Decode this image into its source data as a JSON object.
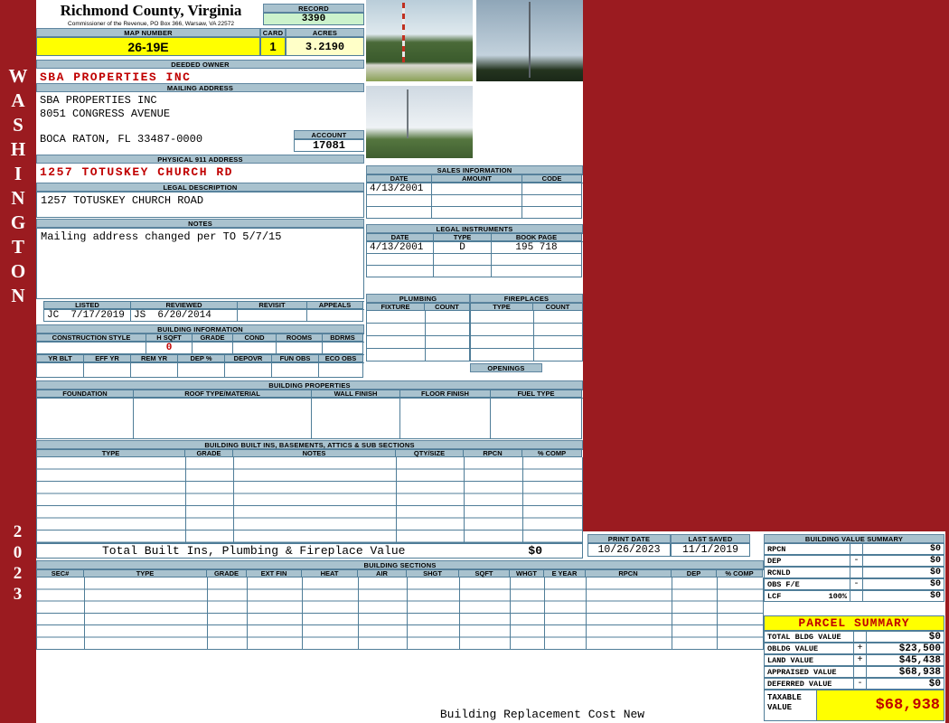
{
  "colors": {
    "maroon": "#9B1B20",
    "header_bar": "#A9C2CE",
    "border": "#4F7D98",
    "highlight_yellow": "#FFFF00",
    "light_yellow": "#FFFFC8",
    "light_green": "#CCF2CC",
    "red_text": "#C00000"
  },
  "sidebar": {
    "district": "WASHINGTON",
    "year": "2023"
  },
  "header": {
    "county": "Richmond County, Virginia",
    "office_line": "Commissioner of the Revenue, PO Box 366, Warsaw, VA 22572",
    "record_label": "RECORD",
    "record_value": "3390",
    "map_number_label": "MAP NUMBER",
    "map_number_value": "26-19E",
    "card_label": "CARD",
    "card_value": "1",
    "acres_label": "ACRES",
    "acres_value": "3.2190"
  },
  "owner": {
    "deeded_owner_label": "DEEDED OWNER",
    "deeded_owner_value": "SBA PROPERTIES INC",
    "mailing_label": "MAILING ADDRESS",
    "mailing_line1": "SBA PROPERTIES INC",
    "mailing_line2": "8051 CONGRESS AVENUE",
    "mailing_line3": "BOCA RATON, FL 33487-0000",
    "account_label": "ACCOUNT",
    "account_value": "17081",
    "physical_label": "PHYSICAL 911 ADDRESS",
    "physical_value": "1257 TOTUSKEY CHURCH RD",
    "legal_label": "LEGAL DESCRIPTION",
    "legal_value": "1257 TOTUSKEY CHURCH ROAD",
    "notes_label": "NOTES",
    "notes_value": "Mailing address changed per TO 5/7/15"
  },
  "sales": {
    "title": "SALES INFORMATION",
    "headers": [
      "DATE",
      "AMOUNT",
      "CODE"
    ],
    "rows": [
      [
        "4/13/2001",
        "",
        ""
      ],
      [
        "",
        "",
        ""
      ],
      [
        "",
        "",
        ""
      ]
    ]
  },
  "instruments": {
    "title": "LEGAL INSTRUMENTS",
    "headers": [
      "DATE",
      "TYPE",
      "BOOK PAGE"
    ],
    "rows": [
      [
        "4/13/2001",
        "D",
        "195 718"
      ],
      [
        "",
        "",
        ""
      ],
      [
        "",
        "",
        ""
      ]
    ]
  },
  "plumbing": {
    "title": "PLUMBING",
    "headers": [
      "FIXTURE",
      "COUNT"
    ]
  },
  "fireplaces": {
    "title": "FIREPLACES",
    "headers": [
      "TYPE",
      "COUNT"
    ],
    "openings_label": "OPENINGS"
  },
  "review": {
    "listed_label": "LISTED",
    "listed_value": "JC  7/17/2019",
    "reviewed_label": "REVIEWED",
    "reviewed_value": "JS  6/20/2014",
    "revisit_label": "REVISIT",
    "appeals_label": "APPEALS"
  },
  "building_info": {
    "title": "BUILDING INFORMATION",
    "row1_headers": [
      "CONSTRUCTION STYLE",
      "H SQFT",
      "GRADE",
      "COND",
      "ROOMS",
      "BDRMS"
    ],
    "h_sqft_value": "0",
    "row2_headers": [
      "YR BLT",
      "EFF YR",
      "REM YR",
      "DEP %",
      "DEPOVR",
      "FUN OBS",
      "ECO OBS"
    ]
  },
  "building_props": {
    "title": "BUILDING PROPERTIES",
    "headers": [
      "FOUNDATION",
      "ROOF TYPE/MATERIAL",
      "WALL FINISH",
      "FLOOR FINISH",
      "FUEL TYPE"
    ]
  },
  "built_ins": {
    "title": "BUILDING BUILT INS, BASEMENTS, ATTICS & SUB SECTIONS",
    "headers": [
      "TYPE",
      "GRADE",
      "NOTES",
      "QTY/SIZE",
      "RPCN",
      "% COMP"
    ],
    "total_label": "Total Built Ins, Plumbing & Fireplace Value",
    "total_value": "$0"
  },
  "dates": {
    "print_date_label": "PRINT DATE",
    "print_date_value": "10/26/2023",
    "last_saved_label": "LAST SAVED",
    "last_saved_value": "11/1/2019"
  },
  "bvs": {
    "title": "BUILDING VALUE SUMMARY",
    "rows": [
      {
        "label": "RPCN",
        "op": "",
        "value": "$0"
      },
      {
        "label": "DEP",
        "op": "-",
        "value": "$0"
      },
      {
        "label": "RCNLD",
        "op": "",
        "value": "$0"
      },
      {
        "label": "OBS F/E",
        "op": "-",
        "value": "$0"
      },
      {
        "label": "LCF",
        "pct": "100%",
        "op": "",
        "value": "$0"
      }
    ]
  },
  "building_sections": {
    "title": "BUILDING SECTIONS",
    "headers": [
      "SEC#",
      "TYPE",
      "GRADE",
      "EXT FIN",
      "HEAT",
      "AIR",
      "SHGT",
      "SQFT",
      "WHGT",
      "E YEAR",
      "RPCN",
      "DEP",
      "% COMP"
    ]
  },
  "parcel": {
    "title": "PARCEL SUMMARY",
    "rows": [
      {
        "label": "TOTAL BLDG VALUE",
        "op": "",
        "value": "$0"
      },
      {
        "label": "OBLDG VALUE",
        "op": "+",
        "value": "$23,500"
      },
      {
        "label": "LAND VALUE",
        "op": "+",
        "value": "$45,438"
      },
      {
        "label": "APPRAISED VALUE",
        "op": "",
        "value": "$68,938"
      },
      {
        "label": "DEFERRED VALUE",
        "op": "-",
        "value": "$0"
      }
    ],
    "taxable_label": "TAXABLE VALUE",
    "taxable_value": "$68,938"
  },
  "footer": {
    "note": "Building Replacement Cost New"
  }
}
